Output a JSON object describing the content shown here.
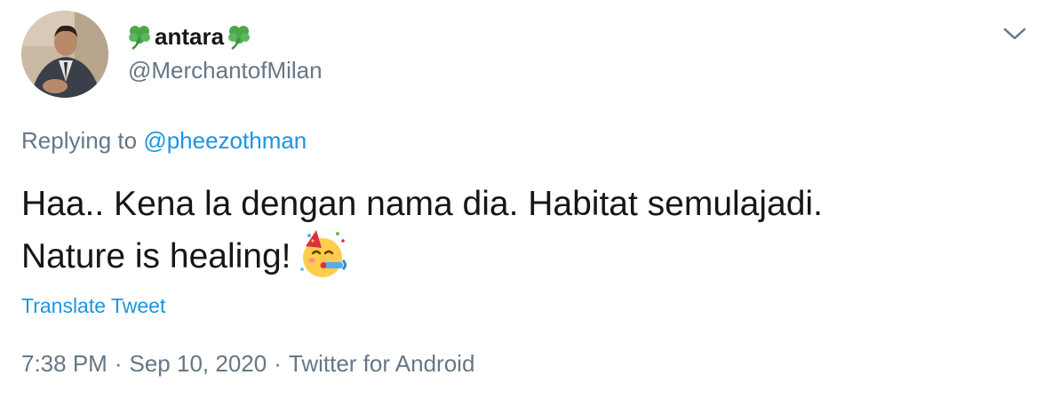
{
  "user": {
    "display_name": "antara",
    "display_name_decorations": [
      "shamrock-icon",
      "shamrock-icon"
    ],
    "handle": "@MerchantofMilan"
  },
  "reply": {
    "prefix": "Replying to",
    "mention": "@pheezothman"
  },
  "tweet": {
    "line1": "Haa.. Kena la dengan nama dia. Habitat semulajadi.",
    "line2": "Nature is healing!",
    "emoji": "partying-face-icon"
  },
  "translate_label": "Translate Tweet",
  "meta": {
    "time": "7:38 PM",
    "separator": "·",
    "date": "Sep 10, 2020",
    "source": "Twitter for Android"
  },
  "colors": {
    "text": "#14171a",
    "secondary": "#657786",
    "link": "#1b95e0",
    "clover": "#4ca64c"
  }
}
